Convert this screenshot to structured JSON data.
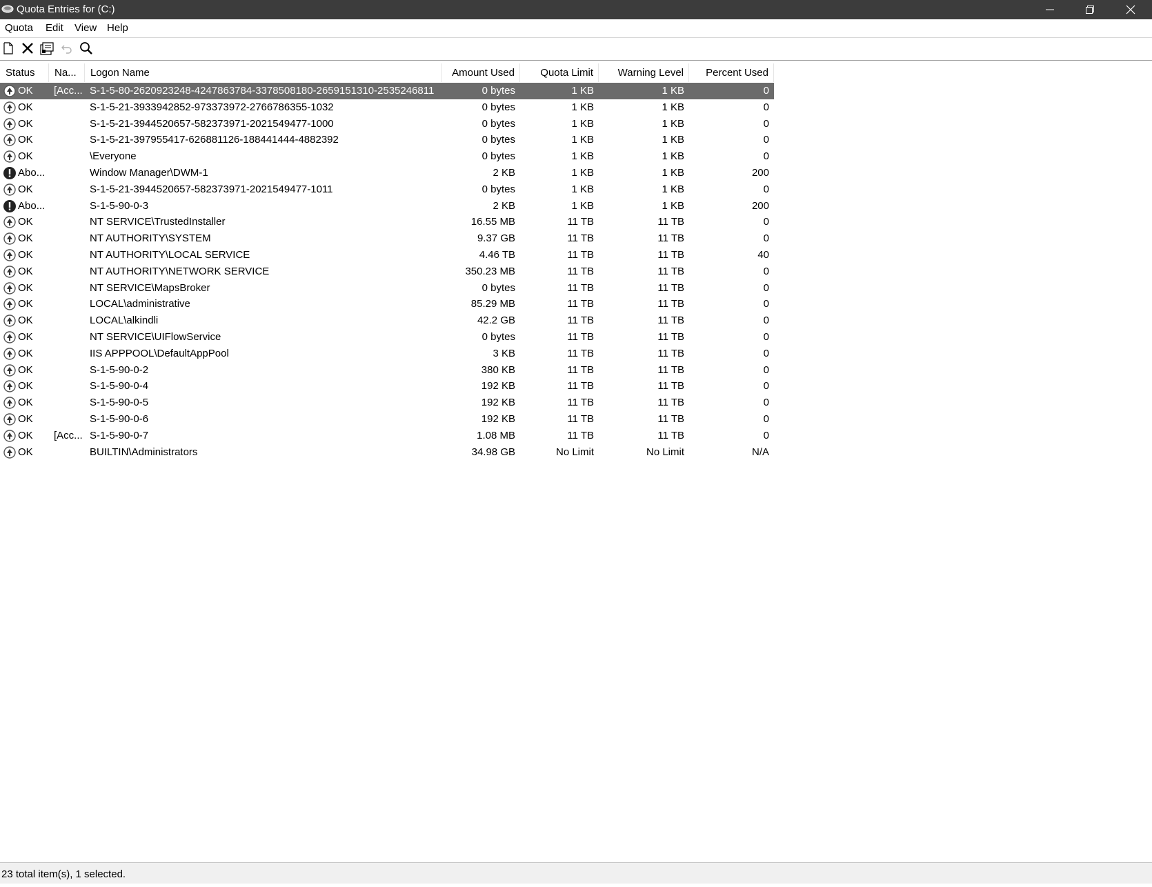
{
  "window": {
    "title": "Quota Entries for  (C:)",
    "colors": {
      "titlebar": "#3c3c3c",
      "selection": "#6b6b6b"
    }
  },
  "menu": [
    "Quota",
    "Edit",
    "View",
    "Help"
  ],
  "toolbar": {
    "buttons": [
      "new-entry-icon",
      "delete-icon",
      "properties-icon",
      "undo-icon",
      "find-icon"
    ]
  },
  "columns": [
    "Status",
    "Na...",
    "Logon Name",
    "Amount Used",
    "Quota Limit",
    "Warning Level",
    "Percent Used"
  ],
  "rows": [
    {
      "status": "OK",
      "name": "[Acc...",
      "logon": "S-1-5-80-2620923248-4247863784-3378508180-2659151310-2535246811",
      "used": "0 bytes",
      "limit": "1 KB",
      "warning": "1 KB",
      "percent": "0",
      "icon": "ok",
      "selected": true
    },
    {
      "status": "OK",
      "name": "",
      "logon": "S-1-5-21-3933942852-973373972-2766786355-1032",
      "used": "0 bytes",
      "limit": "1 KB",
      "warning": "1 KB",
      "percent": "0",
      "icon": "ok"
    },
    {
      "status": "OK",
      "name": "",
      "logon": "S-1-5-21-3944520657-582373971-2021549477-1000",
      "used": "0 bytes",
      "limit": "1 KB",
      "warning": "1 KB",
      "percent": "0",
      "icon": "ok"
    },
    {
      "status": "OK",
      "name": "",
      "logon": "S-1-5-21-397955417-626881126-188441444-4882392",
      "used": "0 bytes",
      "limit": "1 KB",
      "warning": "1 KB",
      "percent": "0",
      "icon": "ok"
    },
    {
      "status": "OK",
      "name": "",
      "logon": "\\Everyone",
      "used": "0 bytes",
      "limit": "1 KB",
      "warning": "1 KB",
      "percent": "0",
      "icon": "ok"
    },
    {
      "status": "Abo...",
      "name": "",
      "logon": "Window Manager\\DWM-1",
      "used": "2 KB",
      "limit": "1 KB",
      "warning": "1 KB",
      "percent": "200",
      "icon": "warning"
    },
    {
      "status": "OK",
      "name": "",
      "logon": "S-1-5-21-3944520657-582373971-2021549477-1011",
      "used": "0 bytes",
      "limit": "1 KB",
      "warning": "1 KB",
      "percent": "0",
      "icon": "ok"
    },
    {
      "status": "Abo...",
      "name": "",
      "logon": "S-1-5-90-0-3",
      "used": "2 KB",
      "limit": "1 KB",
      "warning": "1 KB",
      "percent": "200",
      "icon": "warning"
    },
    {
      "status": "OK",
      "name": "",
      "logon": "NT SERVICE\\TrustedInstaller",
      "used": "16.55 MB",
      "limit": "11 TB",
      "warning": "11 TB",
      "percent": "0",
      "icon": "ok"
    },
    {
      "status": "OK",
      "name": "",
      "logon": "NT AUTHORITY\\SYSTEM",
      "used": "9.37 GB",
      "limit": "11 TB",
      "warning": "11 TB",
      "percent": "0",
      "icon": "ok"
    },
    {
      "status": "OK",
      "name": "",
      "logon": "NT AUTHORITY\\LOCAL SERVICE",
      "used": "4.46 TB",
      "limit": "11 TB",
      "warning": "11 TB",
      "percent": "40",
      "icon": "ok"
    },
    {
      "status": "OK",
      "name": "",
      "logon": "NT AUTHORITY\\NETWORK SERVICE",
      "used": "350.23 MB",
      "limit": "11 TB",
      "warning": "11 TB",
      "percent": "0",
      "icon": "ok"
    },
    {
      "status": "OK",
      "name": "",
      "logon": "NT SERVICE\\MapsBroker",
      "used": "0 bytes",
      "limit": "11 TB",
      "warning": "11 TB",
      "percent": "0",
      "icon": "ok"
    },
    {
      "status": "OK",
      "name": "",
      "logon": "LOCAL\\administrative",
      "used": "85.29 MB",
      "limit": "11 TB",
      "warning": "11 TB",
      "percent": "0",
      "icon": "ok"
    },
    {
      "status": "OK",
      "name": "",
      "logon": "LOCAL\\alkindli",
      "used": "42.2 GB",
      "limit": "11 TB",
      "warning": "11 TB",
      "percent": "0",
      "icon": "ok"
    },
    {
      "status": "OK",
      "name": "",
      "logon": "NT SERVICE\\UIFlowService",
      "used": "0 bytes",
      "limit": "11 TB",
      "warning": "11 TB",
      "percent": "0",
      "icon": "ok"
    },
    {
      "status": "OK",
      "name": "",
      "logon": "IIS APPPOOL\\DefaultAppPool",
      "used": "3 KB",
      "limit": "11 TB",
      "warning": "11 TB",
      "percent": "0",
      "icon": "ok"
    },
    {
      "status": "OK",
      "name": "",
      "logon": "S-1-5-90-0-2",
      "used": "380 KB",
      "limit": "11 TB",
      "warning": "11 TB",
      "percent": "0",
      "icon": "ok"
    },
    {
      "status": "OK",
      "name": "",
      "logon": "S-1-5-90-0-4",
      "used": "192 KB",
      "limit": "11 TB",
      "warning": "11 TB",
      "percent": "0",
      "icon": "ok"
    },
    {
      "status": "OK",
      "name": "",
      "logon": "S-1-5-90-0-5",
      "used": "192 KB",
      "limit": "11 TB",
      "warning": "11 TB",
      "percent": "0",
      "icon": "ok"
    },
    {
      "status": "OK",
      "name": "",
      "logon": "S-1-5-90-0-6",
      "used": "192 KB",
      "limit": "11 TB",
      "warning": "11 TB",
      "percent": "0",
      "icon": "ok"
    },
    {
      "status": "OK",
      "name": "[Acc...",
      "logon": "S-1-5-90-0-7",
      "used": "1.08 MB",
      "limit": "11 TB",
      "warning": "11 TB",
      "percent": "0",
      "icon": "ok"
    },
    {
      "status": "OK",
      "name": "",
      "logon": "BUILTIN\\Administrators",
      "used": "34.98 GB",
      "limit": "No Limit",
      "warning": "No Limit",
      "percent": "N/A",
      "icon": "ok"
    }
  ],
  "statusbar": {
    "text": "23 total item(s), 1 selected."
  }
}
